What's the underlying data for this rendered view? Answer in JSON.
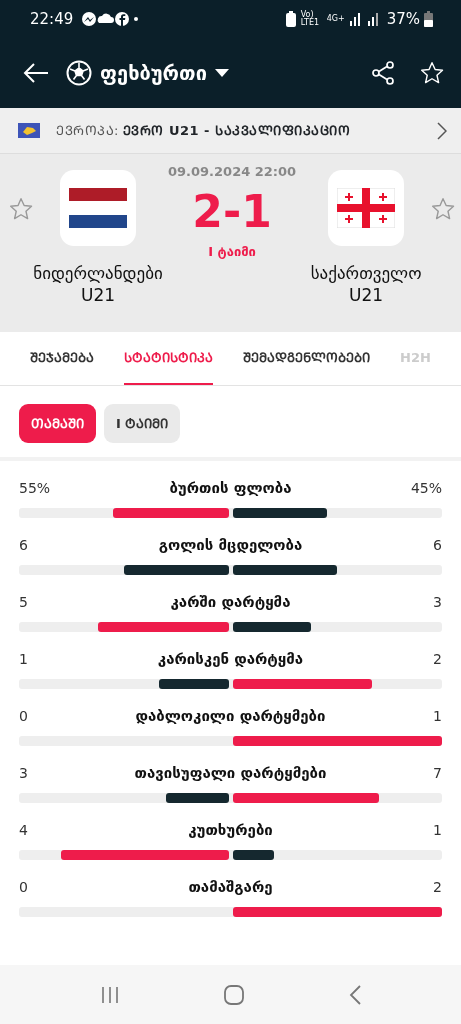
{
  "status_bar": {
    "time": "22:49",
    "network": "Vo) LTE1",
    "data": "4G+",
    "battery": "37%"
  },
  "app_bar": {
    "title": "ფეხბურთი"
  },
  "league": {
    "country": "ᲔᲕᲠᲝᲞᲐ:",
    "name": "ᲔᲕᲠᲝ U21 - ᲡᲐᲙᲕᲐᲚᲘᲤᲘᲙᲐᲪᲘᲝ"
  },
  "match": {
    "datetime": "09.09.2024 22:00",
    "score": "2-1",
    "period": "I ტაიმი",
    "home": {
      "name": "ნიდერლანდები U21",
      "favorite": false
    },
    "away": {
      "name": "საქართველო U21",
      "favorite": false
    }
  },
  "tabs": [
    {
      "label": "ᲨᲔᲯᲐᲛᲔᲑᲐ",
      "selected": false
    },
    {
      "label": "ᲡᲢᲐᲢᲘᲡᲢᲘᲙᲐ",
      "selected": true
    },
    {
      "label": "ᲨᲔᲛᲐᲓᲒᲔᲜᲚᲝᲑᲔᲑᲘ",
      "selected": false
    },
    {
      "label": "H2H",
      "selected": false
    }
  ],
  "filters": [
    {
      "label": "ᲗᲐᲛᲐᲨᲘ",
      "selected": true
    },
    {
      "label": "I ᲢᲐᲘᲛᲘ",
      "selected": false
    }
  ],
  "stats": [
    {
      "label": "ბურთის ფლობა",
      "home": "55%",
      "away": "45%"
    },
    {
      "label": "გოლის მცდელობა",
      "home": "6",
      "away": "6"
    },
    {
      "label": "კარში დარტყმა",
      "home": "5",
      "away": "3"
    },
    {
      "label": "კარისკენ დარტყმა",
      "home": "1",
      "away": "2"
    },
    {
      "label": "დაბლოკილი დარტყმები",
      "home": "0",
      "away": "1"
    },
    {
      "label": "თავისუფალი დარტყმები",
      "home": "3",
      "away": "7"
    },
    {
      "label": "კუთხურები",
      "home": "4",
      "away": "1"
    },
    {
      "label": "თამაშგარე",
      "home": "0",
      "away": "2"
    }
  ]
}
